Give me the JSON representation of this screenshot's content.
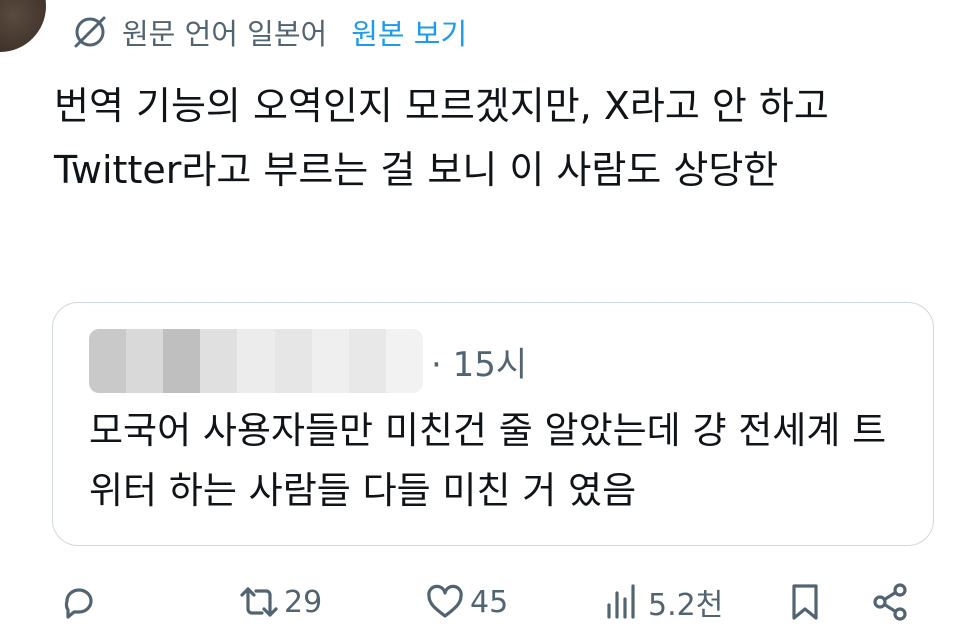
{
  "translation": {
    "label": "원문 언어 일본어",
    "show_original": "원본 보기"
  },
  "tweet": {
    "text": "번역 기능의 오역인지 모르겠지만, X라고 안 하고 Twitter라고 부르는 걸 보니 이 사람도 상당한"
  },
  "quoted_tweet": {
    "time": "· 15시",
    "text": "모국어 사용자들만 미친건 줄 알았는데 걍 전세계 트위터 하는 사람들 다들 미친 거 였음"
  },
  "actions": {
    "retweets": "29",
    "likes": "45",
    "views": "5.2천"
  },
  "colors": {
    "text": "#0f1419",
    "secondary": "#536471",
    "link": "#1d9bf0",
    "border": "#cfd9de"
  }
}
